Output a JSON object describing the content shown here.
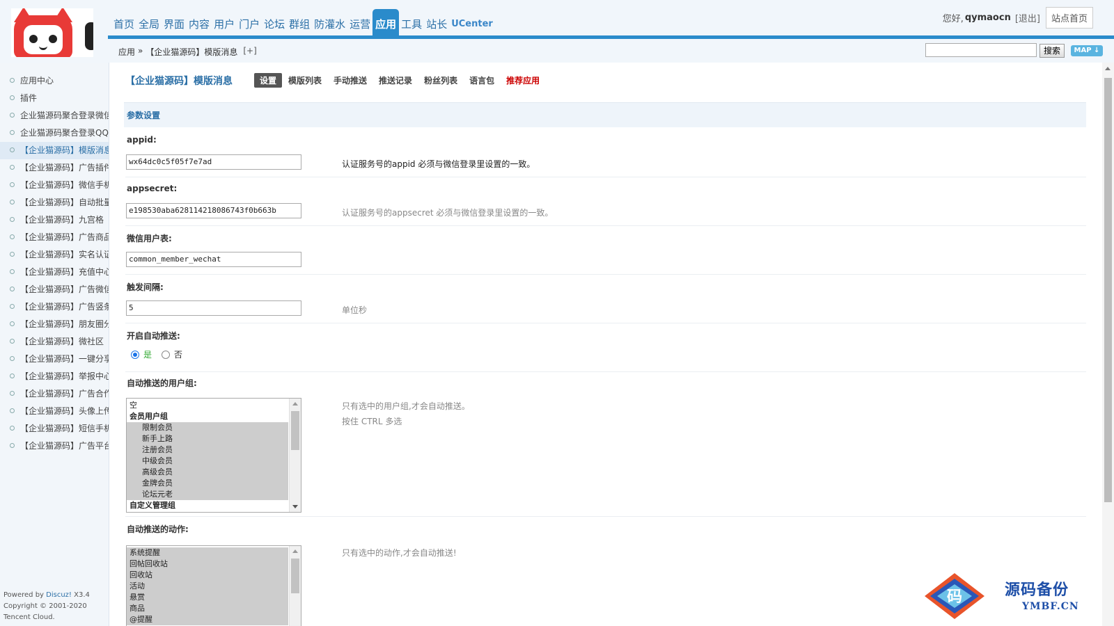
{
  "header": {
    "nav": [
      {
        "label": "首页"
      },
      {
        "label": "全局"
      },
      {
        "label": "界面"
      },
      {
        "label": "内容"
      },
      {
        "label": "用户"
      },
      {
        "label": "门户"
      },
      {
        "label": "论坛"
      },
      {
        "label": "群组"
      },
      {
        "label": "防灌水"
      },
      {
        "label": "运营"
      },
      {
        "label": "应用",
        "active": true
      },
      {
        "label": "工具"
      },
      {
        "label": "站长"
      },
      {
        "label": "UCenter"
      }
    ],
    "greeting": "您好,",
    "username": "qymaocn",
    "logout": "[退出]",
    "site_home": "站点首页",
    "breadcrumb": [
      "应用",
      "»",
      "【企业猫源码】模版消息",
      "[+]"
    ],
    "search_button": "搜索",
    "map_button": "MAP ↓"
  },
  "sidebar": {
    "items": [
      {
        "label": "应用中心"
      },
      {
        "label": "插件"
      },
      {
        "label": "企业猫源码聚合登录微信"
      },
      {
        "label": "企业猫源码聚合登录QQ"
      },
      {
        "label": "【企业猫源码】模版消息",
        "active": true
      },
      {
        "label": "【企业猫源码】广告插件"
      },
      {
        "label": "【企业猫源码】微信手机"
      },
      {
        "label": "【企业猫源码】自动批量"
      },
      {
        "label": "【企业猫源码】九宫格"
      },
      {
        "label": "【企业猫源码】广告商品"
      },
      {
        "label": "【企业猫源码】实名认证"
      },
      {
        "label": "【企业猫源码】充值中心"
      },
      {
        "label": "【企业猫源码】广告微信"
      },
      {
        "label": "【企业猫源码】广告竖条"
      },
      {
        "label": "【企业猫源码】朋友圈分"
      },
      {
        "label": "【企业猫源码】微社区"
      },
      {
        "label": "【企业猫源码】一键分享"
      },
      {
        "label": "【企业猫源码】举报中心"
      },
      {
        "label": "【企业猫源码】广告合作"
      },
      {
        "label": "【企业猫源码】头像上传"
      },
      {
        "label": "【企业猫源码】短信手机"
      },
      {
        "label": "【企业猫源码】广告平台"
      }
    ],
    "footer": {
      "powered": "Powered by",
      "discuz": "Discuz!",
      "version": "X3.4",
      "copyright": "Copyright © 2001-2020",
      "company": "Tencent Cloud."
    }
  },
  "main": {
    "plugin_title": "【企业猫源码】模版消息",
    "tabs": [
      {
        "label": "设置",
        "active": true
      },
      {
        "label": "模版列表"
      },
      {
        "label": "手动推送"
      },
      {
        "label": "推送记录"
      },
      {
        "label": "粉丝列表"
      },
      {
        "label": "语言包"
      },
      {
        "label": "推荐应用",
        "highlight": true
      }
    ],
    "section_title": "参数设置",
    "fields": {
      "appid": {
        "label": "appid:",
        "value": "wx64dc0c5f05f7e7ad",
        "hint": "认证服务号的appid 必须与微信登录里设置的一致。"
      },
      "appsecret": {
        "label": "appsecret:",
        "value": "e198530aba628114218086743f0b663b",
        "hint": "认证服务号的appsecret 必须与微信登录里设置的一致。"
      },
      "user_table": {
        "label": "微信用户表:",
        "value": "common_member_wechat"
      },
      "interval": {
        "label": "触发间隔:",
        "value": "5",
        "hint": "单位秒"
      },
      "auto_push": {
        "label": "开启自动推送:",
        "yes": "是",
        "no": "否",
        "selected": "是"
      },
      "user_groups": {
        "label": "自动推送的用户组:",
        "hint1": "只有选中的用户组,才会自动推送。",
        "hint2": "按住 CTRL 多选",
        "options": [
          {
            "label": "空"
          },
          {
            "label": "会员用户组",
            "group": true
          },
          {
            "label": "限制会员",
            "indent": true,
            "selected": true
          },
          {
            "label": "新手上路",
            "indent": true,
            "selected": true
          },
          {
            "label": "注册会员",
            "indent": true,
            "selected": true
          },
          {
            "label": "中级会员",
            "indent": true,
            "selected": true
          },
          {
            "label": "高级会员",
            "indent": true,
            "selected": true
          },
          {
            "label": "金牌会员",
            "indent": true,
            "selected": true
          },
          {
            "label": "论坛元老",
            "indent": true,
            "selected": true
          },
          {
            "label": "自定义管理组",
            "group": true
          }
        ]
      },
      "actions": {
        "label": "自动推送的动作:",
        "hint": "只有选中的动作,才会自动推送!",
        "options": [
          {
            "label": "系统提醒",
            "selected": true
          },
          {
            "label": "回帖回收站",
            "selected": true
          },
          {
            "label": "回收站",
            "selected": true
          },
          {
            "label": "活动",
            "selected": true
          },
          {
            "label": "悬赏",
            "selected": true
          },
          {
            "label": "商品",
            "selected": true
          },
          {
            "label": "@提醒",
            "selected": true
          }
        ]
      }
    }
  },
  "watermark": {
    "title": "源码备份",
    "url": "YMBF.CN",
    "glyph": "码"
  }
}
